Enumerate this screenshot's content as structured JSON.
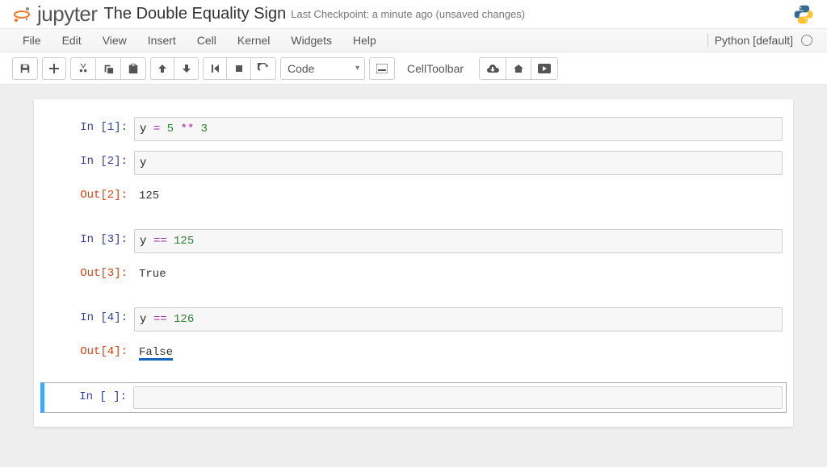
{
  "header": {
    "logo_text": "jupyter",
    "notebook_name": "The Double Equality Sign",
    "checkpoint_prefix": "Last Checkpoint:",
    "checkpoint_time": "a minute ago",
    "checkpoint_status": "(unsaved changes)"
  },
  "menubar": {
    "items": [
      "File",
      "Edit",
      "View",
      "Insert",
      "Cell",
      "Kernel",
      "Widgets",
      "Help"
    ],
    "kernel_name": "Python [default]"
  },
  "toolbar": {
    "celltype": "Code",
    "celltoolbar_label": "CellToolbar"
  },
  "cells": [
    {
      "in_prompt": "In [1]:",
      "code_tokens": [
        [
          "var",
          "y"
        ],
        [
          "txt",
          " "
        ],
        [
          "op",
          "="
        ],
        [
          "txt",
          " "
        ],
        [
          "num",
          "5"
        ],
        [
          "txt",
          " "
        ],
        [
          "op",
          "**"
        ],
        [
          "txt",
          " "
        ],
        [
          "num",
          "3"
        ]
      ]
    },
    {
      "in_prompt": "In [2]:",
      "code_tokens": [
        [
          "var",
          "y"
        ]
      ],
      "out_prompt": "Out[2]:",
      "output": "125"
    },
    {
      "in_prompt": "In [3]:",
      "code_tokens": [
        [
          "var",
          "y"
        ],
        [
          "txt",
          " "
        ],
        [
          "op",
          "=="
        ],
        [
          "txt",
          " "
        ],
        [
          "num",
          "125"
        ]
      ],
      "out_prompt": "Out[3]:",
      "output": "True"
    },
    {
      "in_prompt": "In [4]:",
      "code_tokens": [
        [
          "var",
          "y"
        ],
        [
          "txt",
          " "
        ],
        [
          "op",
          "=="
        ],
        [
          "txt",
          " "
        ],
        [
          "num",
          "126"
        ]
      ],
      "out_prompt": "Out[4]:",
      "output": "False",
      "output_underlined": true
    },
    {
      "in_prompt": "In [ ]:",
      "code_tokens": [],
      "selected": true
    }
  ]
}
